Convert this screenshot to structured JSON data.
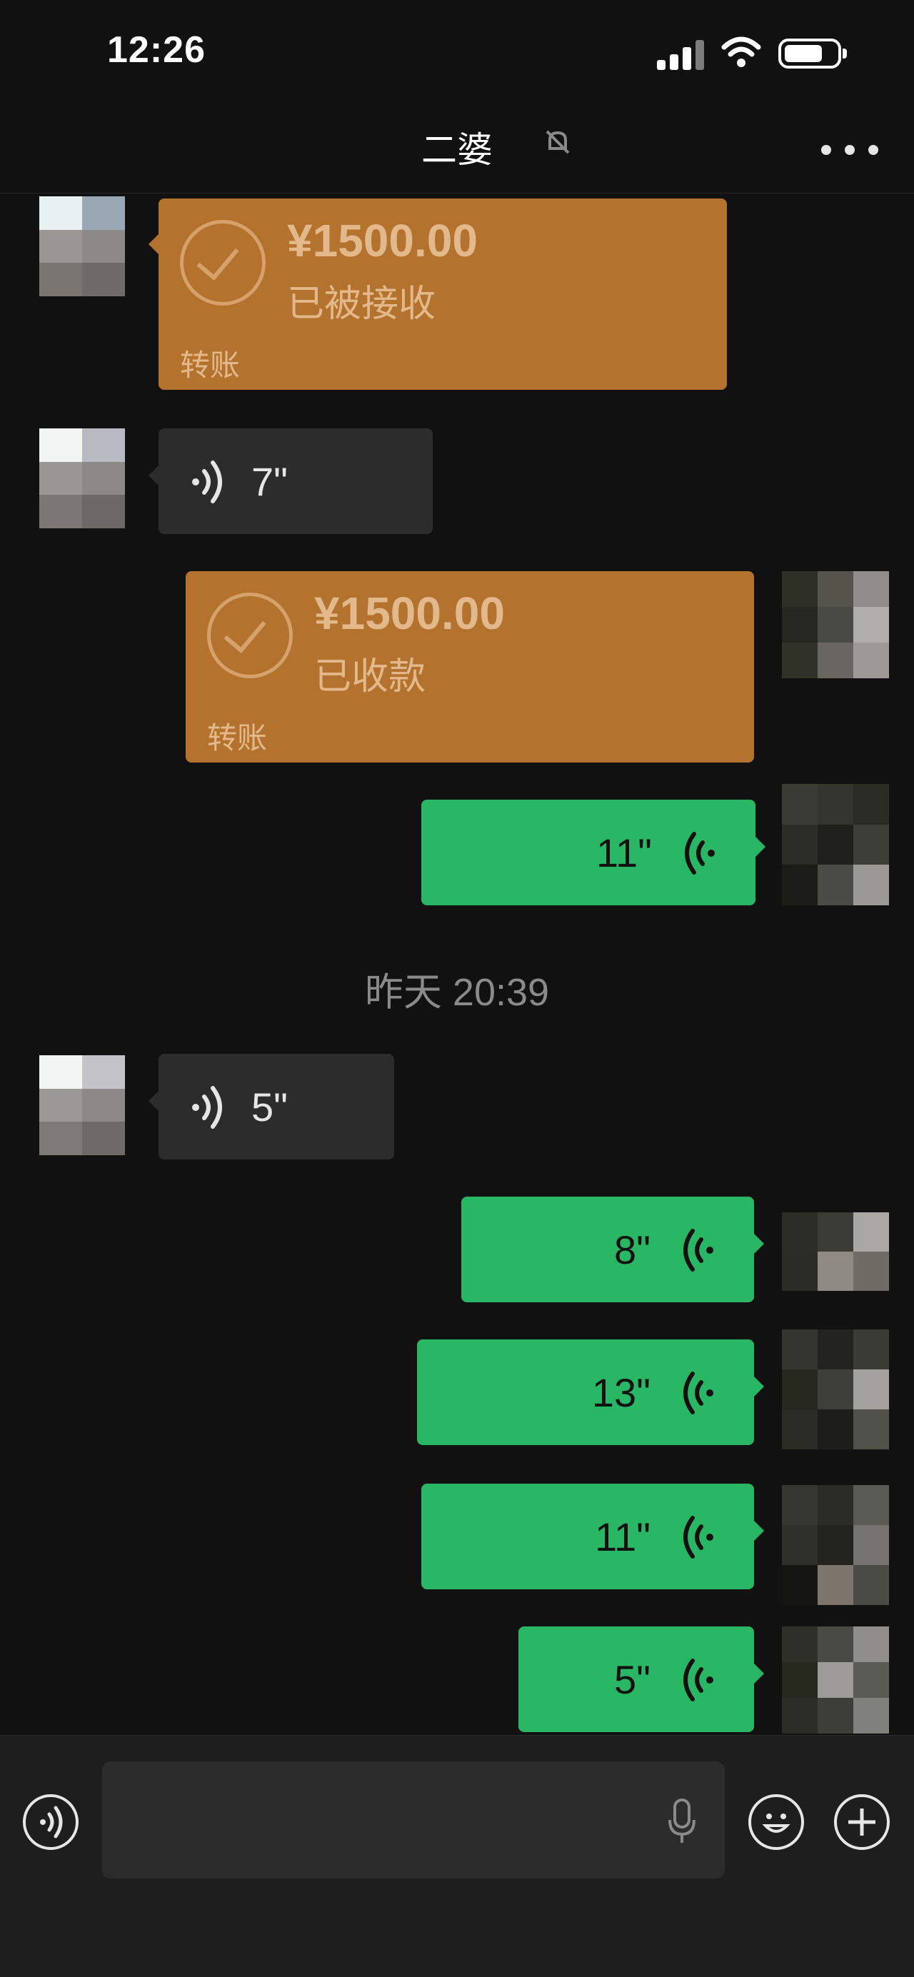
{
  "status_bar": {
    "time": "12:26"
  },
  "header": {
    "title": "二婆"
  },
  "messages": {
    "transfer_received": {
      "amount": "¥1500.00",
      "state": "已被接收",
      "kind": "转账"
    },
    "voice_in_1": {
      "duration": "7\""
    },
    "transfer_collected": {
      "amount": "¥1500.00",
      "state": "已收款",
      "kind": "转账"
    },
    "voice_out_1": {
      "duration": "11\""
    },
    "timestamp": "昨天 20:39",
    "voice_in_2": {
      "duration": "5\""
    },
    "voice_out_2": {
      "duration": "8\""
    },
    "voice_out_3": {
      "duration": "13\""
    },
    "voice_out_4": {
      "duration": "11\""
    },
    "voice_out_5": {
      "duration": "5\""
    }
  },
  "colors": {
    "background": "#111111",
    "transfer_bubble": "#b3732e",
    "incoming_bubble": "#2c2c2c",
    "outgoing_bubble": "#29b765",
    "input_bar": "#1e1e1e"
  },
  "icons": [
    "voice-mode-icon",
    "microphone-icon",
    "emoji-icon",
    "plus-icon",
    "more-icon",
    "mute-icon"
  ]
}
